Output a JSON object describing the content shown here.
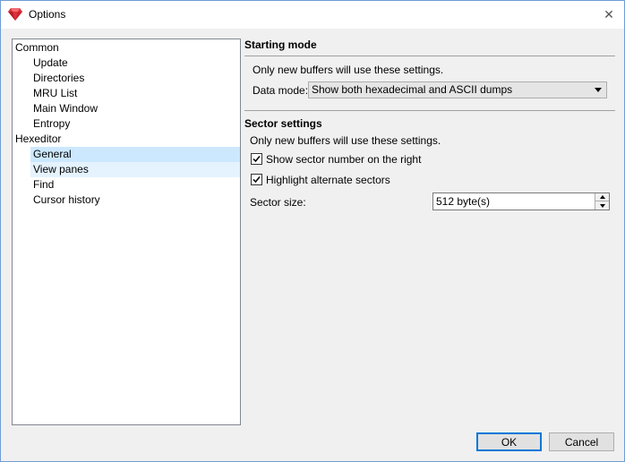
{
  "window": {
    "title": "Options",
    "close_glyph": "✕"
  },
  "tree": {
    "items": [
      {
        "label": "Common",
        "level": 0
      },
      {
        "label": "Update",
        "level": 1
      },
      {
        "label": "Directories",
        "level": 1
      },
      {
        "label": "MRU List",
        "level": 1
      },
      {
        "label": "Main Window",
        "level": 1
      },
      {
        "label": "Entropy",
        "level": 1
      },
      {
        "label": "Hexeditor",
        "level": 0
      },
      {
        "label": "General",
        "level": 1,
        "state": "selected"
      },
      {
        "label": "View panes",
        "level": 1,
        "state": "hover"
      },
      {
        "label": "Find",
        "level": 1
      },
      {
        "label": "Cursor history",
        "level": 1
      }
    ]
  },
  "starting_mode": {
    "title": "Starting mode",
    "note": "Only new buffers will use these settings.",
    "data_mode_label": "Data mode:",
    "data_mode_value": "Show both hexadecimal and ASCII dumps"
  },
  "sector_settings": {
    "title": "Sector settings",
    "note": "Only new buffers will use these settings.",
    "show_sector_label": "Show sector number on the right",
    "show_sector_checked": true,
    "highlight_label": "Highlight alternate sectors",
    "highlight_checked": true,
    "sector_size_label": "Sector size:",
    "sector_size_value": "512 byte(s)"
  },
  "buttons": {
    "ok": "OK",
    "cancel": "Cancel"
  },
  "colors": {
    "selected": "#cce8ff",
    "hover": "#e5f3ff",
    "accent": "#0078d7",
    "icon": "#e0303a"
  }
}
